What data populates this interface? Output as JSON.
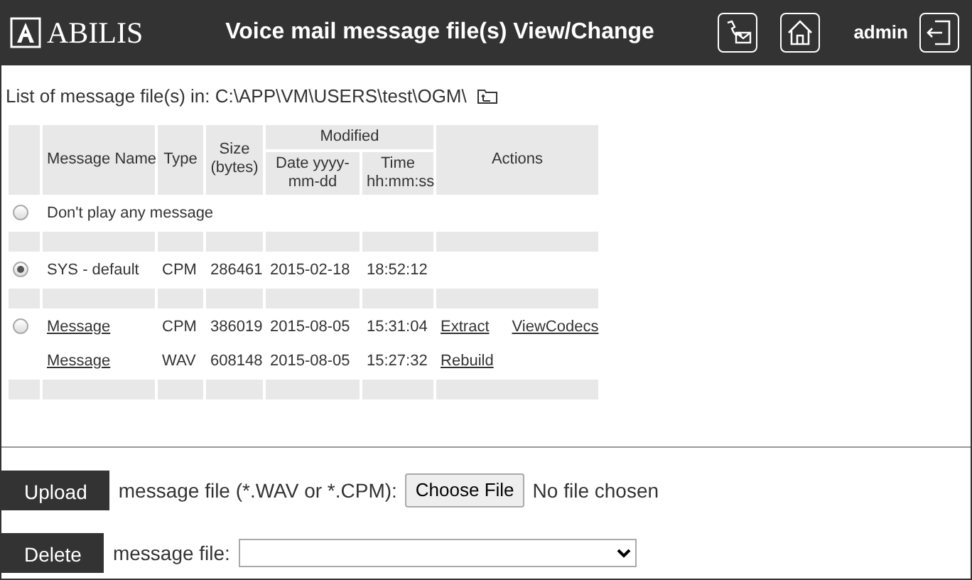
{
  "header": {
    "logo": "ABILIS",
    "title": "Voice mail message file(s) View/Change",
    "user": "admin"
  },
  "path": {
    "label": "List of message file(s) in: C:\\APP\\VM\\USERS\\test\\OGM\\"
  },
  "table": {
    "columns": {
      "name": "Message Name",
      "type": "Type",
      "size": "Size (bytes)",
      "modified": "Modified",
      "date": "Date yyyy-mm-dd",
      "time": "Time hh:mm:ss",
      "actions": "Actions"
    },
    "rows": [
      {
        "kind": "none",
        "radio": true,
        "selected": false,
        "name": "Don't play any message"
      },
      {
        "kind": "spacer"
      },
      {
        "kind": "file",
        "radio": true,
        "selected": true,
        "name": "SYS - default",
        "name_link": false,
        "type": "CPM",
        "size": "286461",
        "date": "2015-02-18",
        "time": "18:52:12",
        "actions": []
      },
      {
        "kind": "spacer"
      },
      {
        "kind": "file",
        "radio": true,
        "selected": false,
        "name": "Message",
        "name_link": true,
        "type": "CPM",
        "size": "386019",
        "date": "2015-08-05",
        "time": "15:31:04",
        "actions": [
          "Extract",
          "ViewCodecs"
        ]
      },
      {
        "kind": "file",
        "radio": false,
        "name": "Message",
        "name_link": true,
        "type": "WAV",
        "size": "608148",
        "date": "2015-08-05",
        "time": "15:27:32",
        "actions": [
          "Rebuild"
        ]
      },
      {
        "kind": "spacer"
      }
    ]
  },
  "upload": {
    "button": "Upload",
    "label": "message file (*.WAV or *.CPM):",
    "choose": "Choose File",
    "status": "No file chosen"
  },
  "delete": {
    "button": "Delete",
    "label": "message file:"
  }
}
